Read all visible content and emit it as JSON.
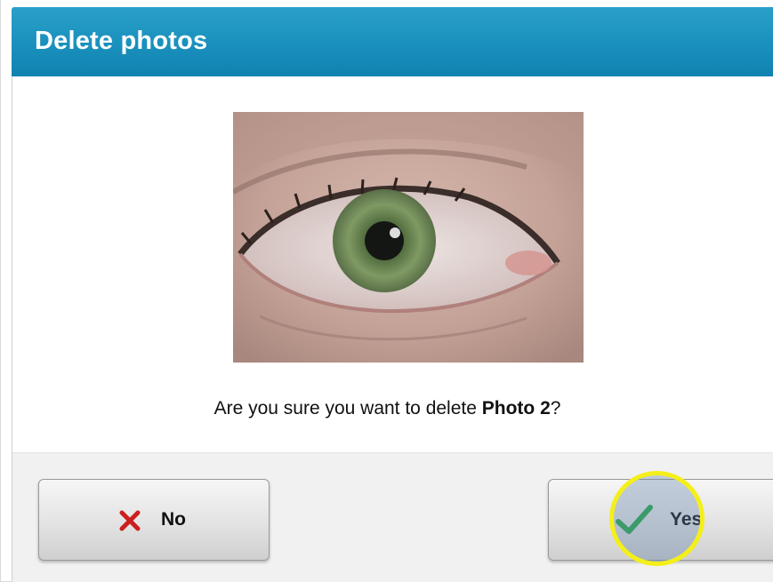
{
  "dialog": {
    "title": "Delete photos",
    "question_prefix": "Are you sure you want to delete ",
    "question_bold": "Photo 2",
    "question_suffix": "?"
  },
  "buttons": {
    "no_label": "No",
    "no_icon": "x-icon",
    "yes_label": "Yes",
    "yes_icon": "checkmark-icon"
  },
  "colors": {
    "title_bar": "#1990bd",
    "no_icon": "#cc1f1f",
    "yes_icon": "#2aa84a",
    "highlight_ring": "#f4ef1a"
  },
  "photo": {
    "subject": "eye-photo"
  }
}
